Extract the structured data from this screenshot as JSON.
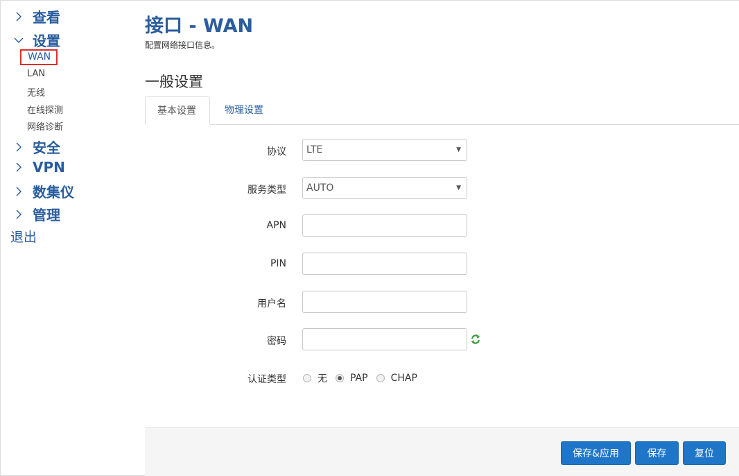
{
  "sidebar": {
    "groups": [
      {
        "label": "查看",
        "expanded": false
      },
      {
        "label": "设置",
        "expanded": true
      },
      {
        "label": "安全",
        "expanded": false
      },
      {
        "label": "VPN",
        "expanded": false
      },
      {
        "label": "数集仪",
        "expanded": false
      },
      {
        "label": "管理",
        "expanded": false
      }
    ],
    "settings_items": [
      {
        "label": "WAN",
        "active": true
      },
      {
        "label": "LAN",
        "active": false
      },
      {
        "label": "无线",
        "active": false
      },
      {
        "label": "在线探测",
        "active": false
      },
      {
        "label": "网络诊断",
        "active": false
      }
    ],
    "logout_label": "退出"
  },
  "main": {
    "title": "接口 - WAN",
    "description": "配置网络接口信息。",
    "section_title": "一般设置",
    "tabs": [
      {
        "label": "基本设置",
        "active": true
      },
      {
        "label": "物理设置",
        "active": false
      }
    ]
  },
  "form": {
    "protocol": {
      "label": "协议",
      "value": "LTE"
    },
    "service_type": {
      "label": "服务类型",
      "value": "AUTO"
    },
    "apn": {
      "label": "APN",
      "value": ""
    },
    "pin": {
      "label": "PIN",
      "value": ""
    },
    "username": {
      "label": "用户名",
      "value": ""
    },
    "password": {
      "label": "密码",
      "value": ""
    },
    "auth_type": {
      "label": "认证类型",
      "options": [
        {
          "label": "无",
          "checked": false
        },
        {
          "label": "PAP",
          "checked": true
        },
        {
          "label": "CHAP",
          "checked": false
        }
      ]
    }
  },
  "footer": {
    "save_apply_label": "保存&应用",
    "save_label": "保存",
    "reset_label": "复位"
  },
  "colors": {
    "accent": "#2a5d9e",
    "button": "#1f76c8",
    "highlight_border": "#d9302c"
  },
  "icons": {
    "collapsed": "chevron-right-icon",
    "expanded": "chevron-down-icon",
    "password_toggle": "refresh-icon",
    "select": "triangle-down-icon"
  }
}
